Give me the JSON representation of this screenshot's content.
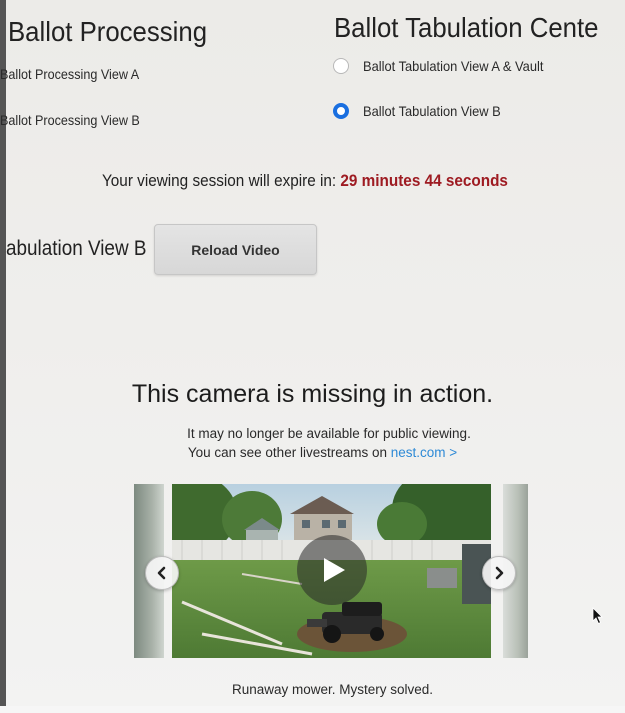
{
  "headers": {
    "processing": "Ballot Processing",
    "tabulation": "Ballot Tabulation Cente"
  },
  "processing_views": [
    {
      "label": "Ballot Processing View A"
    },
    {
      "label": "Ballot Processing View B"
    }
  ],
  "tabulation_views": [
    {
      "label": "Ballot Tabulation View A & Vault",
      "selected": false
    },
    {
      "label": "Ballot Tabulation View B",
      "selected": true
    }
  ],
  "session": {
    "prefix": "Your viewing session will expire in: ",
    "time": "29 minutes 44 seconds"
  },
  "current_view_label": "abulation View B",
  "reload_button": "Reload Video",
  "camera": {
    "title": "This camera is missing in action.",
    "line1": "It may no longer be available for public viewing.",
    "line2_prefix": "You can see other livestreams on ",
    "link_text": "nest.com >",
    "caption": "Runaway mower. Mystery solved."
  },
  "icons": {
    "prev": "chevron-left-icon",
    "next": "chevron-right-icon",
    "play": "play-icon",
    "cursor": "mouse-cursor-icon"
  },
  "colors": {
    "selected_radio": "#1a6fe0",
    "timer": "#9e1b22",
    "link": "#2d8ad6"
  }
}
